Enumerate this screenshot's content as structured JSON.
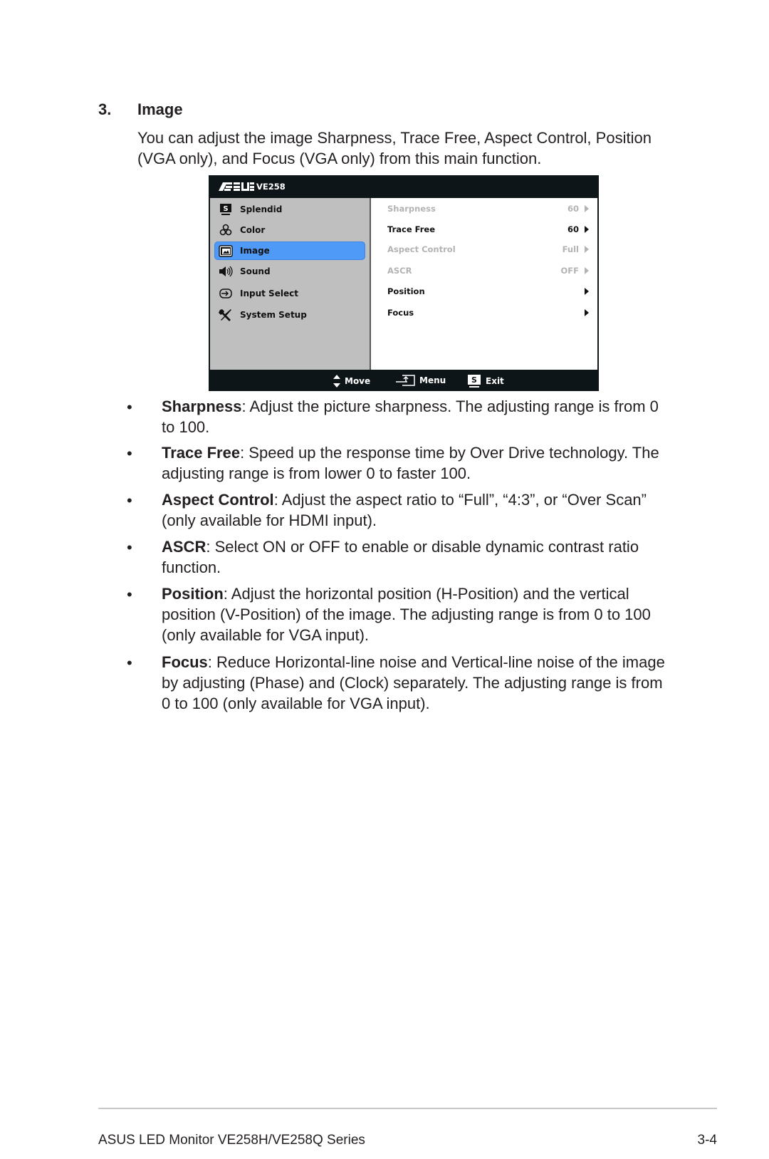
{
  "section": {
    "number": "3.",
    "title": "Image",
    "intro_lines": [
      "You can adjust the image Sharpness, Trace Free, Aspect Control, Position",
      "(VGA only), and Focus (VGA only) from this main function."
    ]
  },
  "osd": {
    "brand": "ASUS",
    "model": "VE258",
    "menu_items": [
      {
        "label": "Splendid",
        "icon": "splendid-s-icon",
        "active": false
      },
      {
        "label": "Color",
        "icon": "color-rgb-icon",
        "active": false
      },
      {
        "label": "Image",
        "icon": "image-icon",
        "active": true
      },
      {
        "label": "Sound",
        "icon": "speaker-icon",
        "active": false
      },
      {
        "label": "Input Select",
        "icon": "input-select-icon",
        "active": false
      },
      {
        "label": "System Setup",
        "icon": "wrench-screwdriver-icon",
        "active": false
      }
    ],
    "options": [
      {
        "label": "Sharpness",
        "value": "60",
        "enabled": false
      },
      {
        "label": "Trace Free",
        "value": "60",
        "enabled": true
      },
      {
        "label": "Aspect Control",
        "value": "Full",
        "enabled": false
      },
      {
        "label": "ASCR",
        "value": "OFF",
        "enabled": false
      },
      {
        "label": "Position",
        "value": "",
        "enabled": true
      },
      {
        "label": "Focus",
        "value": "",
        "enabled": true
      }
    ],
    "footer": {
      "move": "Move",
      "menu": "Menu",
      "exit": "Exit",
      "exit_key": "S"
    },
    "colors": {
      "highlight": "#4f9af7",
      "panel_left": "#bfbfbf",
      "frame": "#0d1518",
      "disabled_text": "#b3b3b3"
    }
  },
  "bullets": [
    {
      "term": "Sharpness",
      "lines": [
        ": Adjust the picture sharpness. The adjusting range is from 0",
        "to 100."
      ]
    },
    {
      "term": "Trace Free",
      "lines": [
        ": Speed up the response time by Over Drive technology. The",
        "adjusting range is from lower 0 to faster 100."
      ]
    },
    {
      "term": "Aspect Control",
      "lines": [
        ": Adjust the aspect ratio to “Full”, “4:3”, or “Over Scan”",
        "(only available for HDMI input)."
      ]
    },
    {
      "term": "ASCR",
      "lines": [
        ": Select ON or OFF to enable or disable dynamic contrast ratio",
        "function."
      ]
    },
    {
      "term": "Position",
      "lines": [
        ": Adjust the horizontal position (H-Position) and the vertical",
        "position (V-Position) of the image. The adjusting range is from 0 to 100",
        "(only available for VGA input)."
      ]
    },
    {
      "term": "Focus",
      "lines": [
        ": Reduce Horizontal-line noise and Vertical-line noise of the image",
        "by adjusting (Phase) and (Clock) separately. The adjusting range is from",
        "0 to 100 (only available for VGA input)."
      ]
    }
  ],
  "page_footer": {
    "title": "ASUS LED Monitor VE258H/VE258Q Series",
    "page": "3-4"
  }
}
